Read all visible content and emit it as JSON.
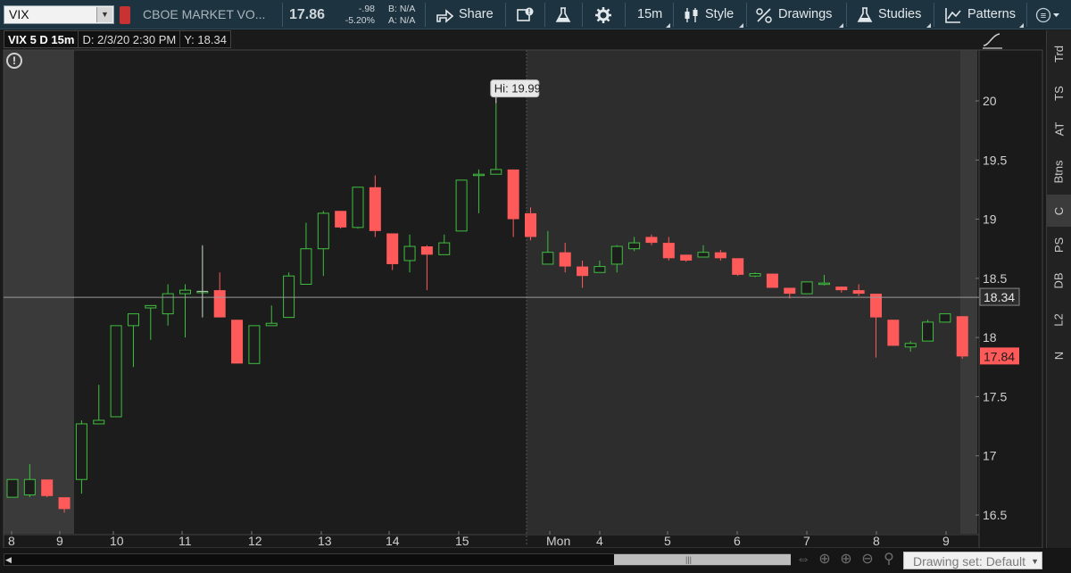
{
  "toolbar": {
    "symbol": "VIX",
    "description": "CBOE MARKET VO...",
    "last_price": "17.86",
    "net_change": "-.98",
    "pct_change": "-5.20%",
    "bid": "B: N/A",
    "ask": "A: N/A",
    "share_label": "Share",
    "timeframe_label": "15m",
    "style_label": "Style",
    "drawings_label": "Drawings",
    "studies_label": "Studies",
    "patterns_label": "Patterns"
  },
  "info": {
    "title": "VIX 5 D 15m",
    "date": "D: 2/3/20 2:30 PM",
    "y_value": "Y: 18.34"
  },
  "side_tabs": [
    "Trd",
    "TS",
    "AT",
    "Btns",
    "C",
    "PS",
    "DB",
    "L2",
    "N"
  ],
  "active_side_tab": "C",
  "drawing_set": "Drawing set: Default",
  "colors": {
    "up": "#3fbf3f",
    "down": "#ff5a5a",
    "session_bg": "#1c1c1c",
    "ext_bg": "#3a3a3a",
    "crosshair_label_bg": "#2d2d2d",
    "last_label_bg": "#ff5a5a",
    "toolbar_bg": "#1e3340"
  },
  "chart_data": {
    "type": "candlestick",
    "ylim": [
      16.4,
      20.5
    ],
    "y_ticks": [
      "16.5",
      "17",
      "17.5",
      "18",
      "18.5",
      "19",
      "19.5",
      "20"
    ],
    "x_ticks": [
      "8",
      "9",
      "10",
      "11",
      "12",
      "13",
      "14",
      "15",
      "Mon",
      "4",
      "5",
      "6",
      "7",
      "8",
      "9"
    ],
    "crosshair_value": "18.34",
    "last_value": "17.84",
    "annotation": "Hi: 19.99",
    "candles": [
      {
        "o": 16.65,
        "h": 16.75,
        "l": 16.65,
        "c": 16.8
      },
      {
        "o": 16.67,
        "h": 16.93,
        "l": 16.65,
        "c": 16.8
      },
      {
        "o": 16.8,
        "h": 16.8,
        "l": 16.65,
        "c": 16.66
      },
      {
        "o": 16.65,
        "h": 16.65,
        "l": 16.52,
        "c": 16.55
      },
      {
        "o": 16.8,
        "h": 17.3,
        "l": 16.68,
        "c": 17.27
      },
      {
        "o": 17.27,
        "h": 17.6,
        "l": 17.27,
        "c": 17.3
      },
      {
        "o": 17.33,
        "h": 18.1,
        "l": 17.33,
        "c": 18.1
      },
      {
        "o": 18.1,
        "h": 18.2,
        "l": 17.75,
        "c": 18.2
      },
      {
        "o": 18.25,
        "h": 18.27,
        "l": 17.98,
        "c": 18.27
      },
      {
        "o": 18.2,
        "h": 18.45,
        "l": 18.1,
        "c": 18.37
      },
      {
        "o": 18.37,
        "h": 18.45,
        "l": 18.0,
        "c": 18.4
      },
      {
        "o": 18.39,
        "h": 18.77,
        "l": 18.17,
        "c": 18.39
      },
      {
        "o": 18.4,
        "h": 18.55,
        "l": 18.17,
        "c": 18.17
      },
      {
        "o": 18.15,
        "h": 18.15,
        "l": 17.78,
        "c": 17.78
      },
      {
        "o": 17.78,
        "h": 18.1,
        "l": 17.78,
        "c": 18.1
      },
      {
        "o": 18.1,
        "h": 18.27,
        "l": 18.1,
        "c": 18.12
      },
      {
        "o": 18.17,
        "h": 18.55,
        "l": 18.17,
        "c": 18.52
      },
      {
        "o": 18.45,
        "h": 18.97,
        "l": 18.45,
        "c": 18.75
      },
      {
        "o": 18.75,
        "h": 19.07,
        "l": 18.52,
        "c": 19.05
      },
      {
        "o": 19.07,
        "h": 19.07,
        "l": 18.92,
        "c": 18.93
      },
      {
        "o": 18.93,
        "h": 19.27,
        "l": 18.92,
        "c": 19.27
      },
      {
        "o": 19.27,
        "h": 19.37,
        "l": 18.85,
        "c": 18.9
      },
      {
        "o": 18.88,
        "h": 18.88,
        "l": 18.57,
        "c": 18.62
      },
      {
        "o": 18.65,
        "h": 18.87,
        "l": 18.55,
        "c": 18.77
      },
      {
        "o": 18.77,
        "h": 18.78,
        "l": 18.4,
        "c": 18.7
      },
      {
        "o": 18.7,
        "h": 18.87,
        "l": 18.7,
        "c": 18.8
      },
      {
        "o": 18.9,
        "h": 19.33,
        "l": 18.9,
        "c": 19.33
      },
      {
        "o": 19.38,
        "h": 19.42,
        "l": 19.05,
        "c": 19.38
      },
      {
        "o": 19.38,
        "h": 19.98,
        "l": 19.38,
        "c": 19.42
      },
      {
        "o": 19.42,
        "h": 19.42,
        "l": 18.85,
        "c": 19.0
      },
      {
        "o": 19.05,
        "h": 19.1,
        "l": 18.82,
        "c": 18.85
      },
      {
        "o": 18.62,
        "h": 18.9,
        "l": 18.62,
        "c": 18.72
      },
      {
        "o": 18.72,
        "h": 18.8,
        "l": 18.55,
        "c": 18.6
      },
      {
        "o": 18.6,
        "h": 18.65,
        "l": 18.42,
        "c": 18.52
      },
      {
        "o": 18.55,
        "h": 18.65,
        "l": 18.55,
        "c": 18.6
      },
      {
        "o": 18.62,
        "h": 18.78,
        "l": 18.55,
        "c": 18.77
      },
      {
        "o": 18.75,
        "h": 18.85,
        "l": 18.73,
        "c": 18.8
      },
      {
        "o": 18.85,
        "h": 18.87,
        "l": 18.78,
        "c": 18.8
      },
      {
        "o": 18.8,
        "h": 18.85,
        "l": 18.65,
        "c": 18.67
      },
      {
        "o": 18.7,
        "h": 18.7,
        "l": 18.64,
        "c": 18.65
      },
      {
        "o": 18.68,
        "h": 18.78,
        "l": 18.68,
        "c": 18.72
      },
      {
        "o": 18.72,
        "h": 18.74,
        "l": 18.65,
        "c": 18.67
      },
      {
        "o": 18.67,
        "h": 18.67,
        "l": 18.52,
        "c": 18.53
      },
      {
        "o": 18.52,
        "h": 18.55,
        "l": 18.51,
        "c": 18.54
      },
      {
        "o": 18.54,
        "h": 18.54,
        "l": 18.42,
        "c": 18.42
      },
      {
        "o": 18.42,
        "h": 18.42,
        "l": 18.33,
        "c": 18.37
      },
      {
        "o": 18.37,
        "h": 18.47,
        "l": 18.37,
        "c": 18.47
      },
      {
        "o": 18.45,
        "h": 18.53,
        "l": 18.44,
        "c": 18.46
      },
      {
        "o": 18.43,
        "h": 18.43,
        "l": 18.38,
        "c": 18.4
      },
      {
        "o": 18.4,
        "h": 18.45,
        "l": 18.35,
        "c": 18.37
      },
      {
        "o": 18.37,
        "h": 18.37,
        "l": 17.83,
        "c": 18.17
      },
      {
        "o": 18.15,
        "h": 18.15,
        "l": 17.93,
        "c": 17.93
      },
      {
        "o": 17.92,
        "h": 17.97,
        "l": 17.88,
        "c": 17.95
      },
      {
        "o": 17.97,
        "h": 18.15,
        "l": 17.97,
        "c": 18.13
      },
      {
        "o": 18.13,
        "h": 18.2,
        "l": 18.13,
        "c": 18.2
      },
      {
        "o": 18.18,
        "h": 18.18,
        "l": 17.82,
        "c": 17.84
      }
    ]
  }
}
